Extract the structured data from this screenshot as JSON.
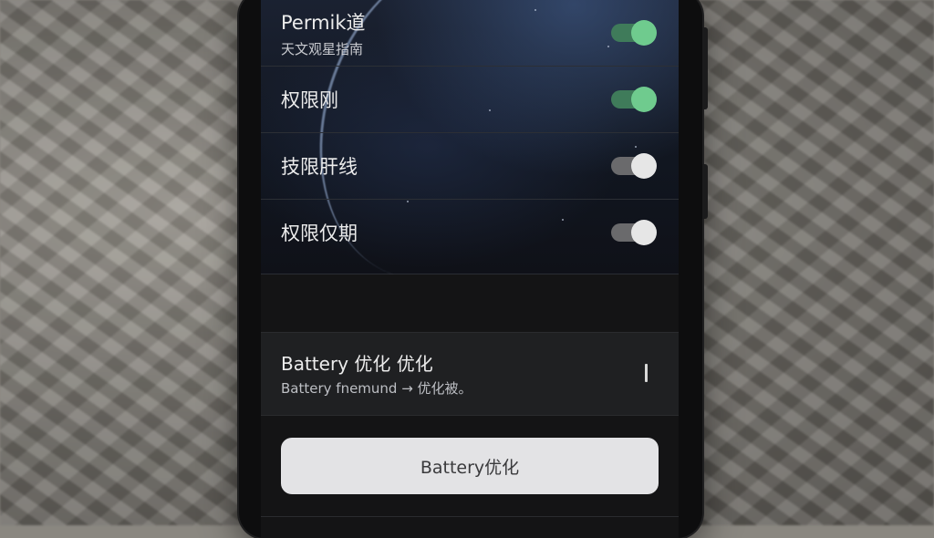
{
  "permissions": {
    "rows": [
      {
        "title": "Permik道",
        "subtitle": "天文观星指南",
        "enabled": true
      },
      {
        "title": "权限刚",
        "subtitle": "",
        "enabled": true
      },
      {
        "title": "技限肝线",
        "subtitle": "",
        "enabled": false
      },
      {
        "title": "权限仅期",
        "subtitle": "",
        "enabled": false
      }
    ]
  },
  "battery": {
    "title": "Battery 优化 优化",
    "subtitle": "Battery fnemund → 优化被。"
  },
  "action_button": {
    "label": "Battery优化"
  },
  "colors": {
    "toggle_on": "#6fcb8e",
    "toggle_off": "#e6e6e6",
    "button_bg": "#e3e3e5"
  }
}
